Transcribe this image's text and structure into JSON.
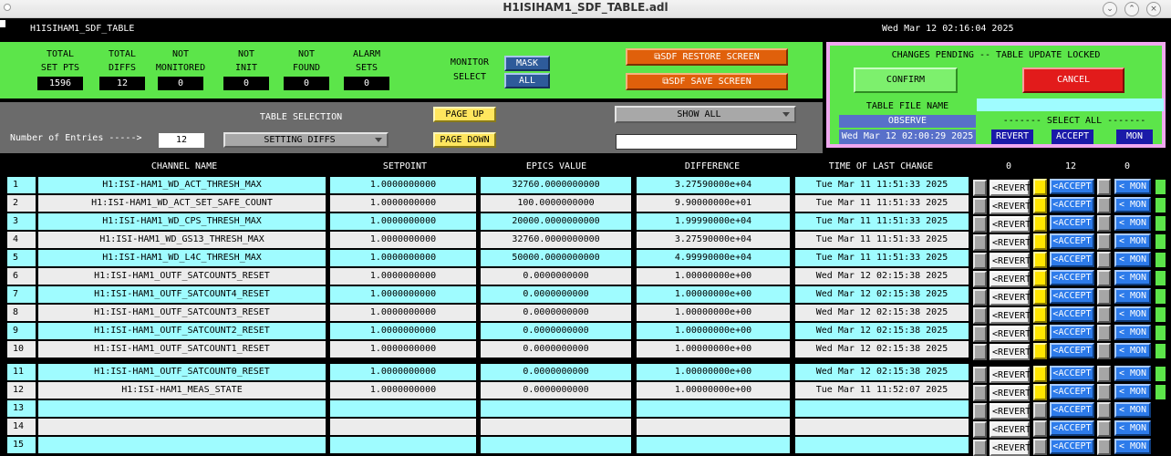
{
  "window": {
    "title": "H1ISIHAM1_SDF_TABLE.adl"
  },
  "header": {
    "left": "H1ISIHAM1_SDF_TABLE",
    "datetime": "Wed Mar 12 02:16:04 2025"
  },
  "stats": [
    {
      "label1": "TOTAL",
      "label2": "SET PTS",
      "value": "1596"
    },
    {
      "label1": "TOTAL",
      "label2": "DIFFS",
      "value": "12"
    },
    {
      "label1": "NOT",
      "label2": "MONITORED",
      "value": "0"
    },
    {
      "label1": "NOT",
      "label2": "INIT",
      "value": "0"
    },
    {
      "label1": "NOT",
      "label2": "FOUND",
      "value": "0"
    },
    {
      "label1": "ALARM",
      "label2": "SETS",
      "value": "0"
    }
  ],
  "monitor_select": {
    "label1": "MONITOR",
    "label2": "SELECT",
    "mask": "MASK",
    "all": "ALL"
  },
  "sdf": {
    "restore": "SDF RESTORE SCREEN",
    "save": "SDF SAVE SCREEN"
  },
  "changes": {
    "title": "CHANGES PENDING -- TABLE UPDATE LOCKED",
    "confirm": "CONFIRM",
    "cancel": "CANCEL",
    "file_label": "TABLE FILE NAME",
    "file_value": "",
    "observe": "OBSERVE",
    "file_date": "Wed Mar 12 02:00:29 2025",
    "select_all": "------- SELECT ALL -------",
    "revert": "REVERT",
    "accept": "ACCEPT",
    "mon": "MON"
  },
  "controls": {
    "entries_label": "Number of Entries ----->",
    "entries_value": "12",
    "table_selection_label": "TABLE SELECTION",
    "table_selection_value": "SETTING DIFFS",
    "page_up": "PAGE UP",
    "page_down": "PAGE DOWN",
    "show_all": "SHOW ALL",
    "search_value": ""
  },
  "table": {
    "headers": {
      "channel": "CHANNEL NAME",
      "setpoint": "SETPOINT",
      "epics": "EPICS VALUE",
      "difference": "DIFFERENCE",
      "time": "TIME OF LAST CHANGE"
    },
    "counts": {
      "revert": "0",
      "accept": "12",
      "mon": "0"
    },
    "revert_label": "<REVERT",
    "accept_label": "<ACCEPT",
    "mon_label": "< MON",
    "rows": [
      {
        "n": "1",
        "channel": "H1:ISI-HAM1_WD_ACT_THRESH_MAX",
        "setpoint": "1.0000000000",
        "epics": "32760.0000000000",
        "diff": "3.27590000e+04",
        "time": "Tue Mar 11 11:51:33 2025",
        "accepted": true
      },
      {
        "n": "2",
        "channel": "H1:ISI-HAM1_WD_ACT_SET_SAFE_COUNT",
        "setpoint": "1.0000000000",
        "epics": "100.0000000000",
        "diff": "9.90000000e+01",
        "time": "Tue Mar 11 11:51:33 2025",
        "accepted": true
      },
      {
        "n": "3",
        "channel": "H1:ISI-HAM1_WD_CPS_THRESH_MAX",
        "setpoint": "1.0000000000",
        "epics": "20000.0000000000",
        "diff": "1.99990000e+04",
        "time": "Tue Mar 11 11:51:33 2025",
        "accepted": true
      },
      {
        "n": "4",
        "channel": "H1:ISI-HAM1_WD_GS13_THRESH_MAX",
        "setpoint": "1.0000000000",
        "epics": "32760.0000000000",
        "diff": "3.27590000e+04",
        "time": "Tue Mar 11 11:51:33 2025",
        "accepted": true
      },
      {
        "n": "5",
        "channel": "H1:ISI-HAM1_WD_L4C_THRESH_MAX",
        "setpoint": "1.0000000000",
        "epics": "50000.0000000000",
        "diff": "4.99990000e+04",
        "time": "Tue Mar 11 11:51:33 2025",
        "accepted": true
      },
      {
        "n": "6",
        "channel": "H1:ISI-HAM1_OUTF_SATCOUNT5_RESET",
        "setpoint": "1.0000000000",
        "epics": "0.0000000000",
        "diff": "1.00000000e+00",
        "time": "Wed Mar 12 02:15:38 2025",
        "accepted": true
      },
      {
        "n": "7",
        "channel": "H1:ISI-HAM1_OUTF_SATCOUNT4_RESET",
        "setpoint": "1.0000000000",
        "epics": "0.0000000000",
        "diff": "1.00000000e+00",
        "time": "Wed Mar 12 02:15:38 2025",
        "accepted": true
      },
      {
        "n": "8",
        "channel": "H1:ISI-HAM1_OUTF_SATCOUNT3_RESET",
        "setpoint": "1.0000000000",
        "epics": "0.0000000000",
        "diff": "1.00000000e+00",
        "time": "Wed Mar 12 02:15:38 2025",
        "accepted": true
      },
      {
        "n": "9",
        "channel": "H1:ISI-HAM1_OUTF_SATCOUNT2_RESET",
        "setpoint": "1.0000000000",
        "epics": "0.0000000000",
        "diff": "1.00000000e+00",
        "time": "Wed Mar 12 02:15:38 2025",
        "accepted": true
      },
      {
        "n": "10",
        "channel": "H1:ISI-HAM1_OUTF_SATCOUNT1_RESET",
        "setpoint": "1.0000000000",
        "epics": "0.0000000000",
        "diff": "1.00000000e+00",
        "time": "Wed Mar 12 02:15:38 2025",
        "accepted": true
      },
      {
        "n": "11",
        "channel": "H1:ISI-HAM1_OUTF_SATCOUNT0_RESET",
        "setpoint": "1.0000000000",
        "epics": "0.0000000000",
        "diff": "1.00000000e+00",
        "time": "Wed Mar 12 02:15:38 2025",
        "accepted": true
      },
      {
        "n": "12",
        "channel": "H1:ISI-HAM1_MEAS_STATE",
        "setpoint": "1.0000000000",
        "epics": "0.0000000000",
        "diff": "1.00000000e+00",
        "time": "Tue Mar 11 11:52:07 2025",
        "accepted": true
      },
      {
        "n": "13",
        "channel": "",
        "setpoint": "",
        "epics": "",
        "diff": "",
        "time": "",
        "accepted": false
      },
      {
        "n": "14",
        "channel": "",
        "setpoint": "",
        "epics": "",
        "diff": "",
        "time": "",
        "accepted": false
      },
      {
        "n": "15",
        "channel": "",
        "setpoint": "",
        "epics": "",
        "diff": "",
        "time": "",
        "accepted": false
      }
    ]
  },
  "colors": {
    "green": "#5ce54a",
    "cyan": "#9ffcff",
    "gray_row": "#ececec",
    "orange": "#e0600b",
    "blue": "#2d7bea",
    "red": "#e21b1b",
    "navy": "#1a1aa8"
  }
}
